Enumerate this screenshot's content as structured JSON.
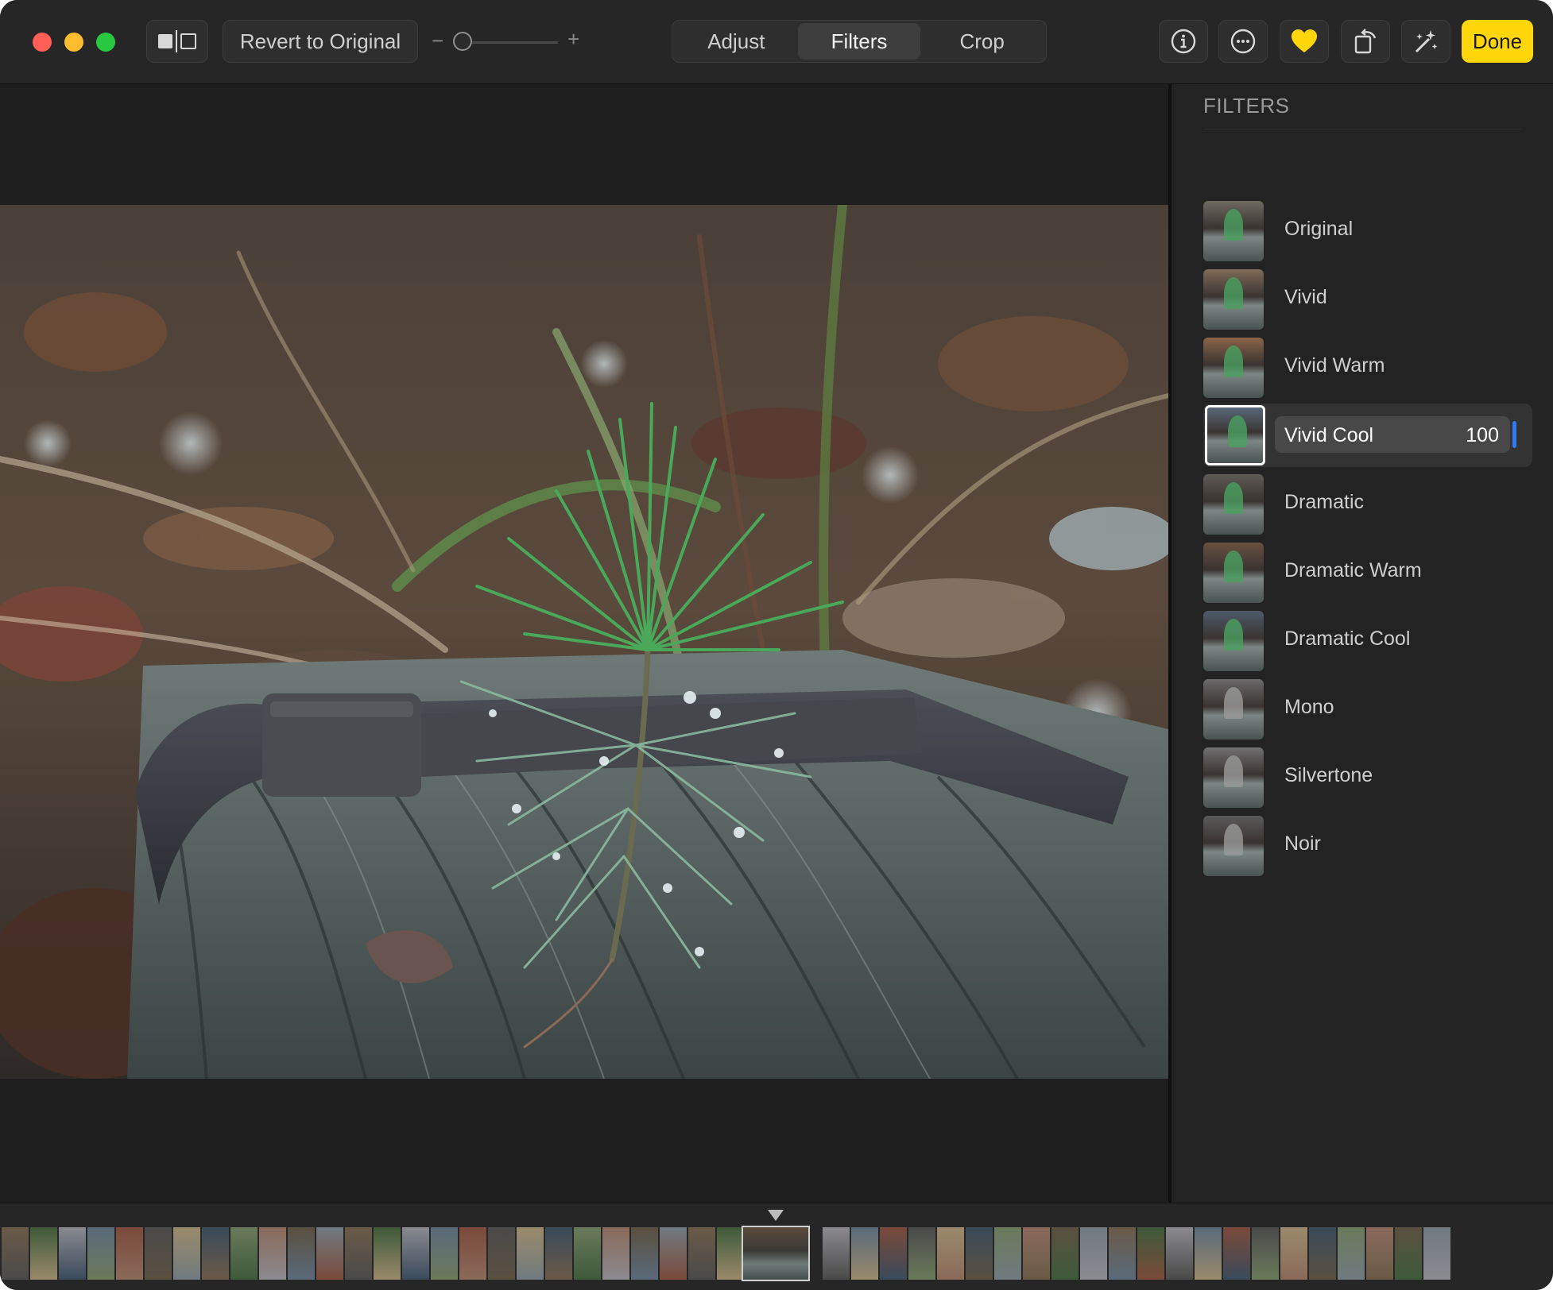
{
  "toolbar": {
    "revert_label": "Revert to Original",
    "zoom_minus": "−",
    "zoom_plus": "+",
    "tabs": [
      {
        "label": "Adjust",
        "active": false
      },
      {
        "label": "Filters",
        "active": true
      },
      {
        "label": "Crop",
        "active": false
      }
    ],
    "icons": [
      "info-icon",
      "more-icon",
      "heart-icon",
      "rotate-icon",
      "magic-wand-icon"
    ],
    "done_label": "Done",
    "accent": "#ffd60a"
  },
  "sidebar": {
    "title": "FILTERS",
    "filters": [
      {
        "label": "Original"
      },
      {
        "label": "Vivid"
      },
      {
        "label": "Vivid Warm"
      },
      {
        "label": "Vivid Cool",
        "selected": true,
        "value": "100"
      },
      {
        "label": "Dramatic"
      },
      {
        "label": "Dramatic Warm"
      },
      {
        "label": "Dramatic Cool"
      },
      {
        "label": "Mono"
      },
      {
        "label": "Silvertone"
      },
      {
        "label": "Noir"
      }
    ],
    "selection_accent": "#2f7bf5"
  }
}
